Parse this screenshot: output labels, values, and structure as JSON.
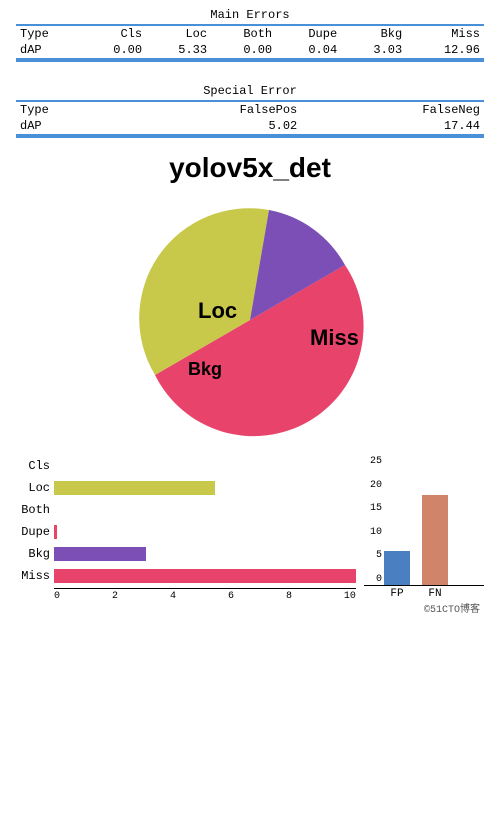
{
  "mainErrors": {
    "title": "Main Errors",
    "headers": [
      "Type",
      "Cls",
      "Loc",
      "Both",
      "Dupe",
      "Bkg",
      "Miss"
    ],
    "rows": [
      [
        "dAP",
        "0.00",
        "5.33",
        "0.00",
        "0.04",
        "3.03",
        "12.96"
      ]
    ]
  },
  "specialError": {
    "title": "Special Error",
    "headers": [
      "Type",
      "FalsePos",
      "FalseNeg"
    ],
    "rows": [
      [
        "dAP",
        "5.02",
        "17.44"
      ]
    ]
  },
  "chartTitle": "yolov5x_det",
  "pieChart": {
    "segments": [
      {
        "label": "Miss",
        "color": "#e8436a",
        "startAngle": -30,
        "endAngle": 150
      },
      {
        "label": "Loc",
        "color": "#c8c84a",
        "startAngle": 150,
        "endAngle": 280
      },
      {
        "label": "Bkg",
        "color": "#7b4fb5",
        "startAngle": 280,
        "endAngle": 330
      }
    ]
  },
  "hBarChart": {
    "labels": [
      "Cls",
      "Loc",
      "Both",
      "Dupe",
      "Bkg",
      "Miss"
    ],
    "values": [
      0,
      5.33,
      0,
      0.04,
      3.03,
      12.96
    ],
    "maxValue": 10,
    "tickLabels": [
      "0",
      "2",
      "4",
      "6",
      "8",
      "10"
    ],
    "colors": [
      "#c8c84a",
      "#c8c84a",
      "#c8c84a",
      "#e8436a",
      "#7b4fb5",
      "#e8436a"
    ]
  },
  "vBarChart": {
    "labels": [
      "FP",
      "FN"
    ],
    "values": [
      5.02,
      17.44
    ],
    "maxValue": 25,
    "tickLabels": [
      "25",
      "20",
      "15",
      "10",
      "5",
      "0"
    ],
    "colors": [
      "#4a7fc1",
      "#d0846a"
    ]
  },
  "watermark": "©51CTO博客"
}
